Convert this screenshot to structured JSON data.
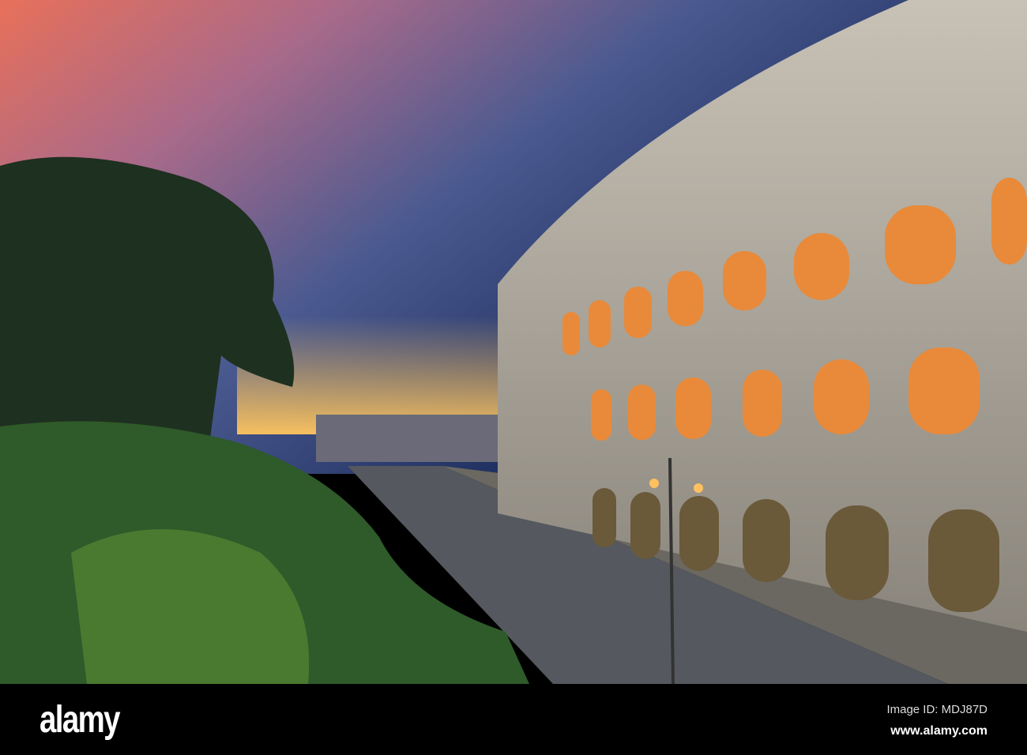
{
  "watermark": {
    "logo": "alamy",
    "image_id": "Image ID: MDJ87D",
    "url": "www.alamy.com"
  },
  "colors": {
    "sky_top": "#2a3a6a",
    "sunset_orange": "#f07a5a",
    "horizon": "#f6c060",
    "stone": "#b8b2a6",
    "arch_glow": "#e88a3a",
    "foliage": "#2f5a2a"
  }
}
